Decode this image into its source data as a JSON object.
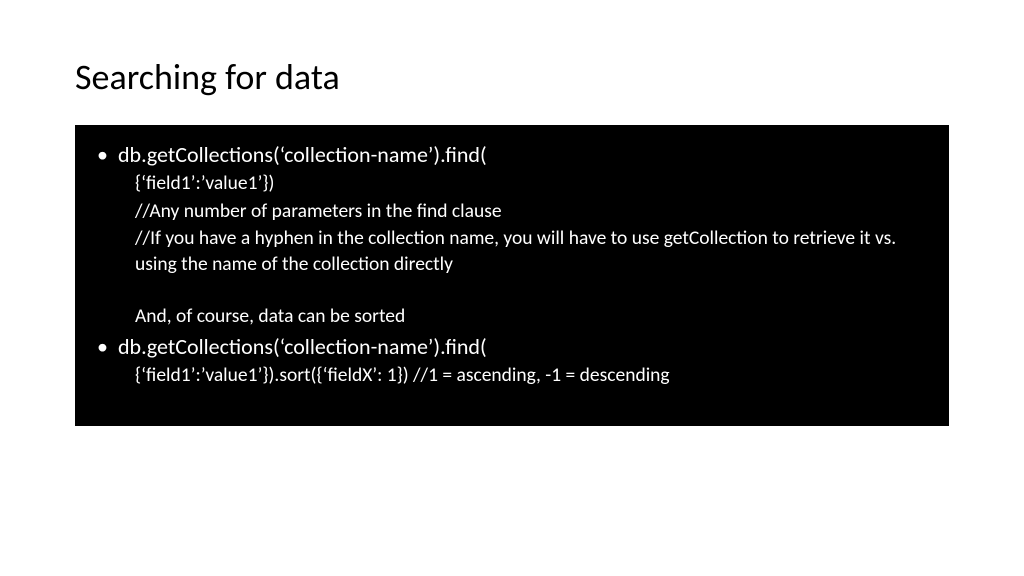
{
  "slide": {
    "title": "Searching for data",
    "bullets": [
      {
        "head": "db.getCollections(‘collection-name’).find(",
        "subs": [
          "{‘field1’:’value1’})",
          "//Any number of parameters in the find clause",
          "//If you have a hyphen in the collection name, you will have to use getCollection to retrieve it vs. using the name of the collection directly",
          "",
          "And, of course, data can be sorted"
        ]
      },
      {
        "head": "db.getCollections(‘collection-name’).find(",
        "subs": [
          "{‘field1’:’value1’}).sort({‘fieldX’: 1}) //1 = ascending, -1 = descending"
        ]
      }
    ]
  }
}
